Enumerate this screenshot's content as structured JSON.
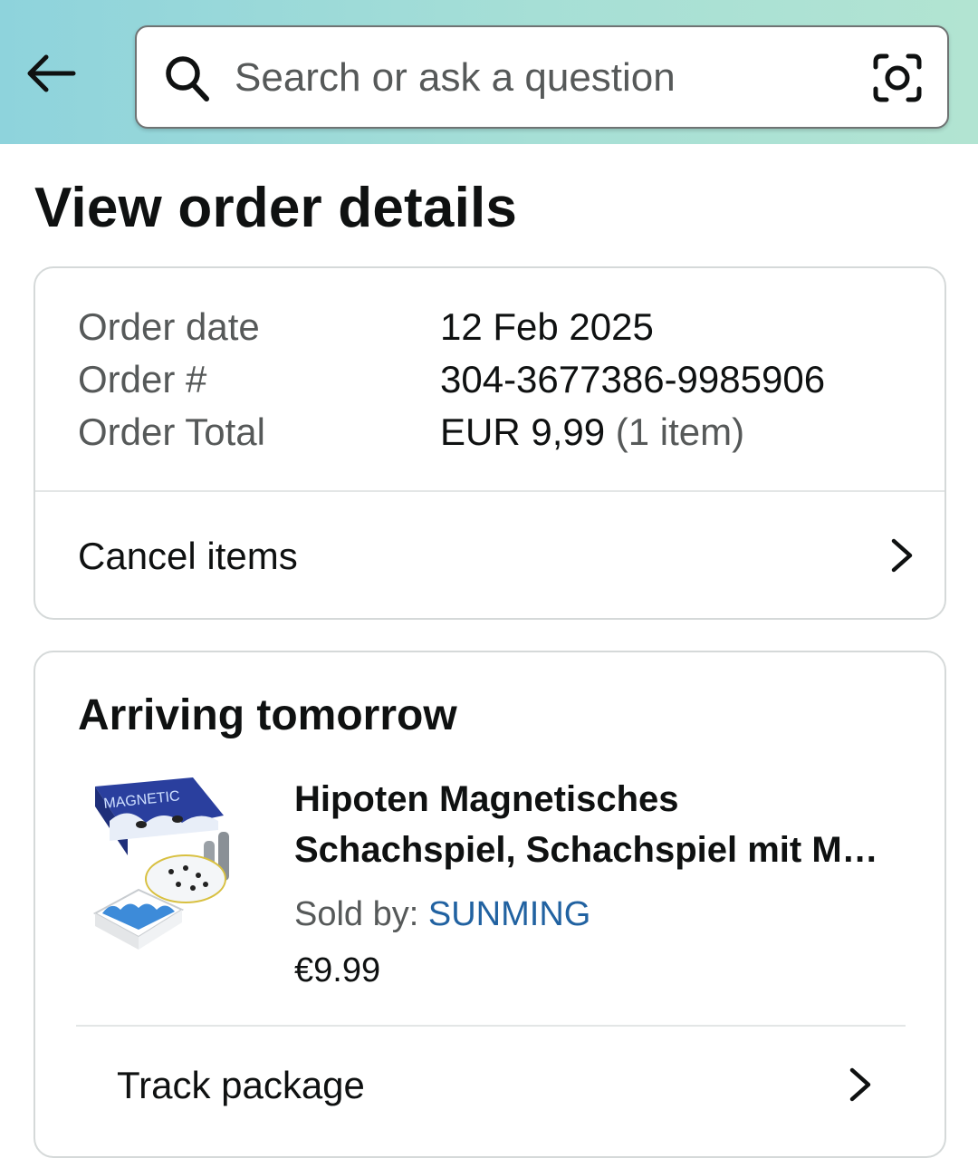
{
  "header": {
    "back_icon": "arrow-left-icon",
    "search": {
      "placeholder": "Search or ask a question",
      "value": "",
      "icon": "search-icon",
      "camera_icon": "camera-lens-icon"
    }
  },
  "page": {
    "title": "View order details"
  },
  "summary": {
    "rows": [
      {
        "label": "Order date",
        "value": "12 Feb 2025",
        "extra": ""
      },
      {
        "label": "Order #",
        "value": "304-3677386-9985906",
        "extra": ""
      },
      {
        "label": "Order Total",
        "value": "EUR 9,99",
        "extra": "(1 item)"
      }
    ],
    "cancel_label": "Cancel items"
  },
  "delivery": {
    "heading": "Arriving tomorrow",
    "product": {
      "title_line1": "Hipoten Magnetisches",
      "title_line2": "Schachspiel, Schachspiel mit M…",
      "sold_by_label": "Sold by: ",
      "seller": "SUNMING",
      "price": "€9.99",
      "image_box_text": "MAGNETIC"
    },
    "track_label": "Track package"
  },
  "colors": {
    "header_gradient_start": "#8ed3dc",
    "header_gradient_end": "#b2e4d2",
    "link_blue": "#2162a1",
    "muted_text": "#565959",
    "card_border": "#d5d9d9"
  }
}
